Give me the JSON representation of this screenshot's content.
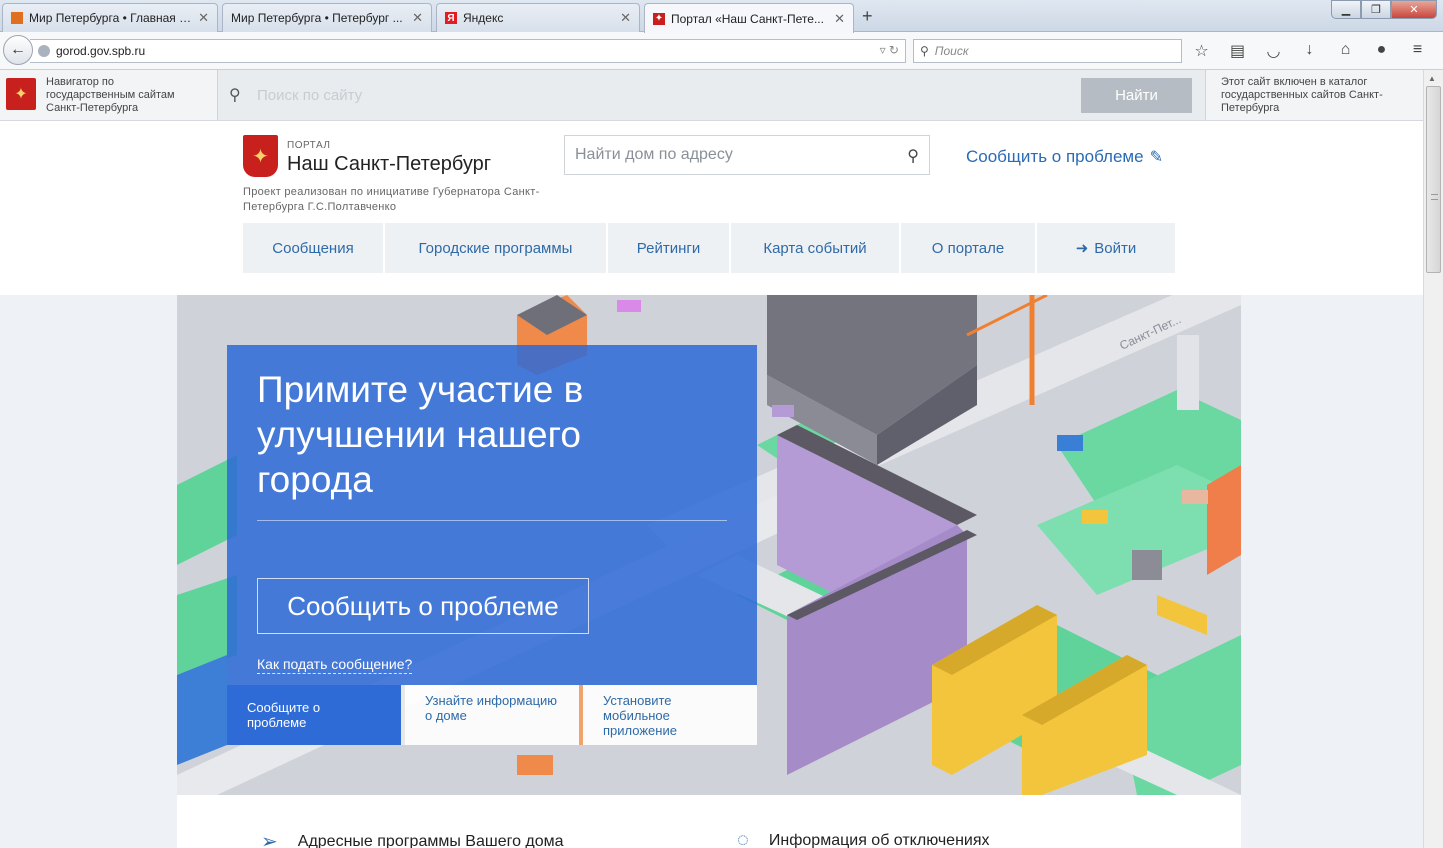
{
  "browser": {
    "tabs": [
      {
        "title": "Мир Петербурга • Главная ст...",
        "favicon": "wp-icon",
        "active": false
      },
      {
        "title": "Мир Петербурга • Петербург ...",
        "favicon": "",
        "active": false
      },
      {
        "title": "Яндекс",
        "favicon": "yandex-icon",
        "active": false
      },
      {
        "title": "Портал «Наш Санкт-Пете...",
        "favicon": "spb-icon",
        "active": true
      }
    ],
    "url_host": "gorod.gov.spb.ru",
    "search_placeholder": "Поиск"
  },
  "gov_navigator": {
    "left_text": "Навигатор по государственным сайтам Санкт-Петербурга",
    "search_placeholder": "Поиск по сайту",
    "find_button": "Найти",
    "right_text": "Этот сайт включен в каталог государственных сайтов Санкт-Петербурга"
  },
  "site": {
    "logo_small": "ПОРТАЛ",
    "logo_title": "Наш Санкт-Петербург",
    "subtitle": "Проект реализован по инициативе Губернатора Санкт-Петербурга Г.С.Полтавченко",
    "address_placeholder": "Найти дом по адресу",
    "report_link": "Сообщить о проблеме",
    "nav": [
      {
        "label": "Сообщения"
      },
      {
        "label": "Городские программы"
      },
      {
        "label": "Рейтинги"
      },
      {
        "label": "Карта событий"
      },
      {
        "label": "О портале"
      },
      {
        "label": "Войти"
      }
    ]
  },
  "hero": {
    "title": "Примите участие в улучшении нашего города",
    "button": "Сообщить о проблеме",
    "howto_link": "Как подать сообщение?",
    "tabs": [
      {
        "label": "Сообщите о проблеме"
      },
      {
        "label": "Узнайте информацию о доме"
      },
      {
        "label": "Установите мобильное приложение"
      }
    ],
    "sign_text": "Санкт-Пет..."
  },
  "bottom": {
    "items": [
      {
        "label": "Адресные программы Вашего дома"
      },
      {
        "label": "Информация об отключениях"
      }
    ]
  },
  "colors": {
    "accent": "#2f6aa8",
    "hero_panel": "#2d69d7",
    "emblem_red": "#c8201d"
  }
}
